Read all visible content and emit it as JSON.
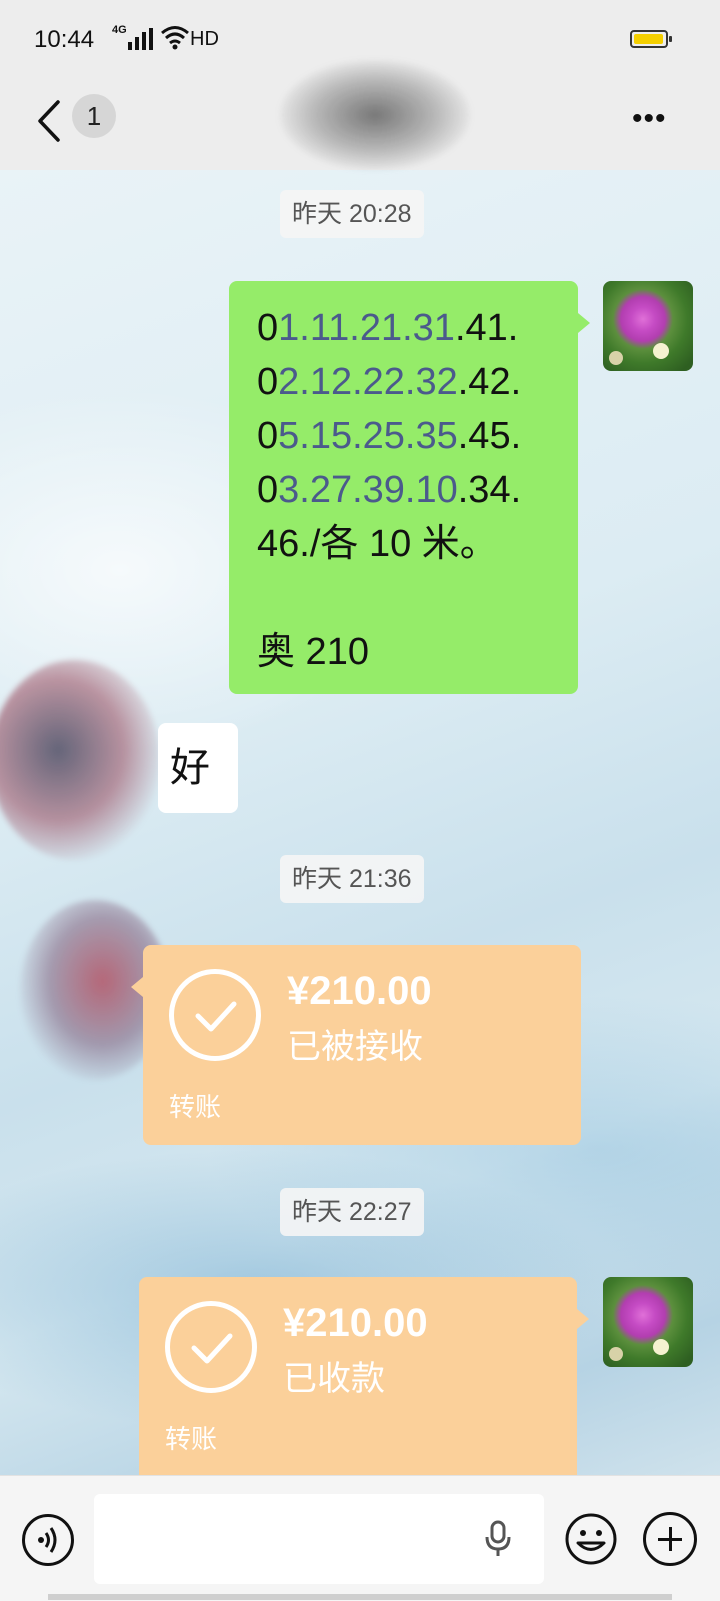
{
  "status_bar": {
    "time": "10:44",
    "network": "4G",
    "hd": "HD"
  },
  "header": {
    "unread_count": "1"
  },
  "messages": {
    "ts1": "昨天 20:28",
    "sent_lines": [
      {
        "a": "0",
        "b": "1.11.21.31",
        "c": ".41."
      },
      {
        "a": "0",
        "b": "2.12.22.32",
        "c": ".42."
      },
      {
        "a": "0",
        "b": "5.15.25.35",
        "c": ".45."
      },
      {
        "a": "0",
        "b": "3.27.39.10",
        "c": ".34."
      }
    ],
    "sent_line5": "46./各 10 米。",
    "sent_line6": "奥 210",
    "reply": "好",
    "ts2": "昨天 21:36",
    "transfer1": {
      "amount": "¥210.00",
      "status": "已被接收",
      "label": "转账"
    },
    "ts3": "昨天 22:27",
    "transfer2": {
      "amount": "¥210.00",
      "status": "已收款",
      "label": "转账"
    }
  },
  "input": {
    "placeholder": ""
  },
  "colors": {
    "sent_bubble": "#95ec69",
    "transfer_bubble": "#fbd09a",
    "bar_bg": "#ededed"
  }
}
